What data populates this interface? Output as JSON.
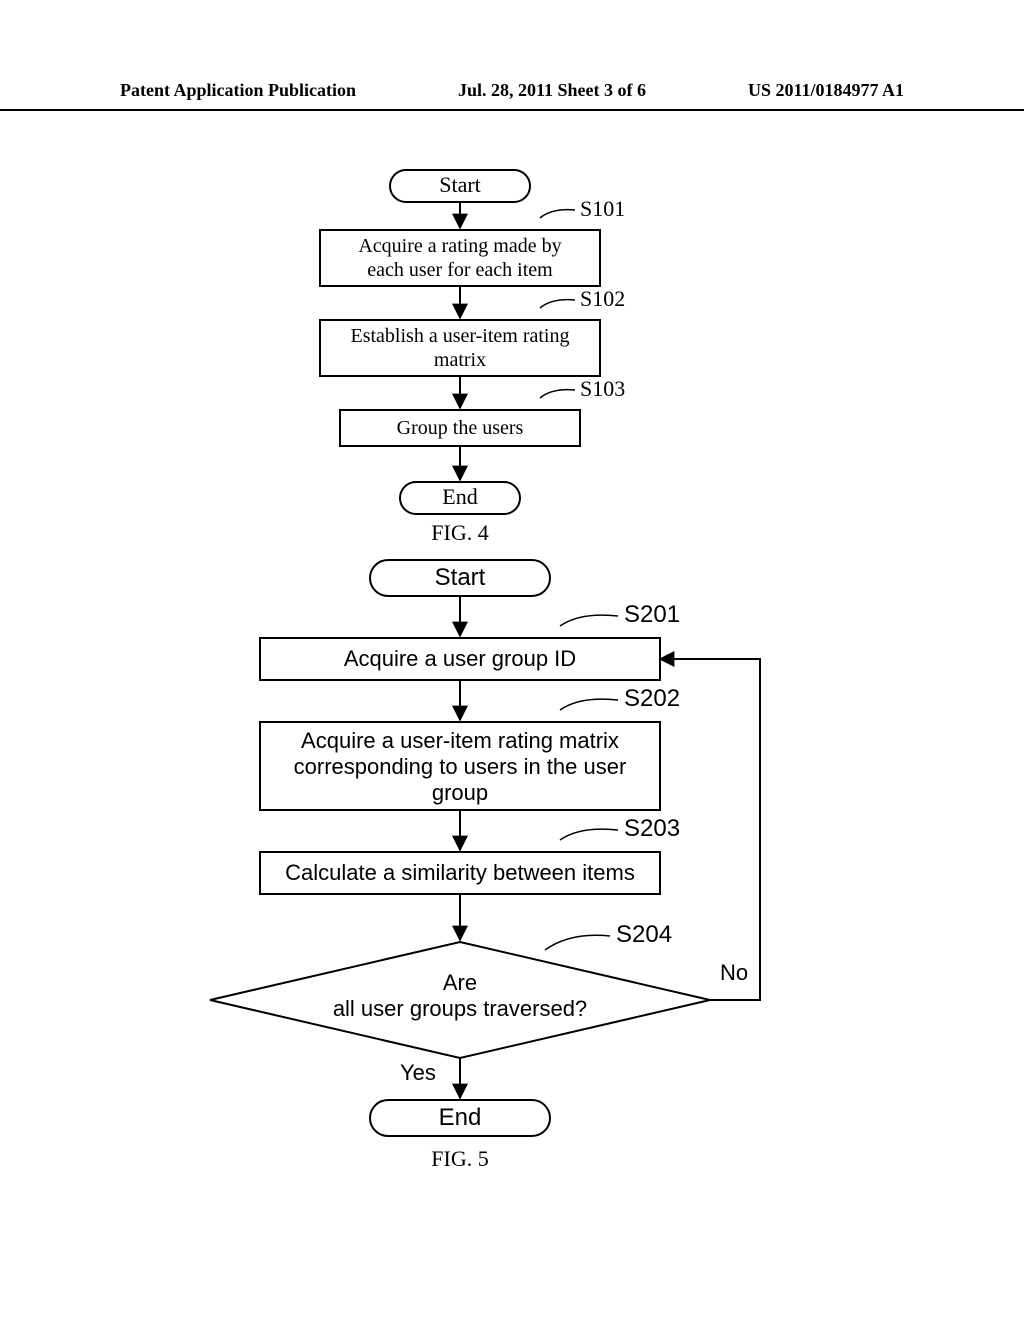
{
  "header": {
    "left": "Patent Application Publication",
    "center": "Jul. 28, 2011  Sheet 3 of 6",
    "right": "US 2011/0184977 A1"
  },
  "fig4": {
    "start": "Start",
    "s101": {
      "label": "S101",
      "text1": "Acquire a rating made by",
      "text2": "each user for each item"
    },
    "s102": {
      "label": "S102",
      "text1": "Establish a user-item rating",
      "text2": "matrix"
    },
    "s103": {
      "label": "S103",
      "text1": "Group the users"
    },
    "end": "End",
    "caption": "FIG. 4"
  },
  "fig5": {
    "start": "Start",
    "s201": {
      "label": "S201",
      "text1": "Acquire a user group ID"
    },
    "s202": {
      "label": "S202",
      "text1": "Acquire a user-item rating matrix",
      "text2": "corresponding to users in the user",
      "text3": "group"
    },
    "s203": {
      "label": "S203",
      "text1": "Calculate a similarity between items"
    },
    "s204": {
      "label": "S204",
      "text1": "Are",
      "text2": "all user groups traversed?"
    },
    "yes": "Yes",
    "no": "No",
    "end": "End",
    "caption": "FIG. 5"
  }
}
